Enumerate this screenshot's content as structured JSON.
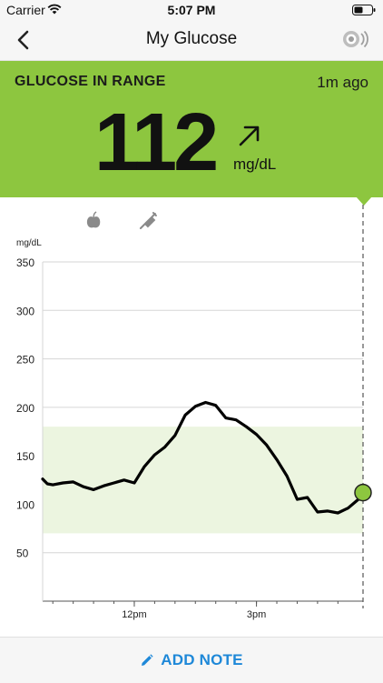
{
  "status_bar": {
    "carrier": "Carrier",
    "time": "5:07 PM"
  },
  "nav": {
    "title": "My Glucose",
    "back_icon": "chevron-left-icon",
    "sensor_icon": "sensor-scan-icon"
  },
  "banner": {
    "status": "GLUCOSE IN RANGE",
    "time_ago": "1m ago",
    "value": "112",
    "unit": "mg/dL",
    "trend_icon": "arrow-up-right-icon",
    "color": "#8dc63f"
  },
  "chart_data": {
    "type": "line",
    "ylabel": "mg/dL",
    "ylim": [
      0,
      350
    ],
    "y_ticks": [
      50,
      100,
      150,
      200,
      250,
      300,
      350
    ],
    "x_tick_labels": [
      "12pm",
      "3pm"
    ],
    "target_range": [
      70,
      180
    ],
    "grid": true,
    "event_markers": [
      {
        "icon": "food-apple-icon",
        "time": "11:00am"
      },
      {
        "icon": "insulin-pen-icon",
        "time": "12:20pm"
      }
    ],
    "series": [
      {
        "values": [
          [
            "9:45",
            126
          ],
          [
            "9:52",
            121
          ],
          [
            "10:00",
            120
          ],
          [
            "10:15",
            122
          ],
          [
            "10:30",
            123
          ],
          [
            "10:45",
            118
          ],
          [
            "11:00",
            115
          ],
          [
            "11:15",
            119
          ],
          [
            "11:30",
            122
          ],
          [
            "11:45",
            125
          ],
          [
            "12:00",
            122
          ],
          [
            "12:15",
            139
          ],
          [
            "12:30",
            151
          ],
          [
            "12:45",
            159
          ],
          [
            "1:00",
            171
          ],
          [
            "1:15",
            192
          ],
          [
            "1:30",
            201
          ],
          [
            "1:45",
            205
          ],
          [
            "2:00",
            202
          ],
          [
            "2:15",
            189
          ],
          [
            "2:30",
            187
          ],
          [
            "2:45",
            180
          ],
          [
            "3:00",
            172
          ],
          [
            "3:15",
            161
          ],
          [
            "3:30",
            146
          ],
          [
            "3:45",
            129
          ],
          [
            "4:00",
            105
          ],
          [
            "4:15",
            107
          ],
          [
            "4:30",
            92
          ],
          [
            "4:45",
            93
          ],
          [
            "5:00",
            91
          ],
          [
            "5:15",
            96
          ],
          [
            "5:30",
            105
          ],
          [
            "5:37",
            112
          ]
        ]
      }
    ],
    "current_point": {
      "time": "5:37",
      "value": 112
    }
  },
  "footer": {
    "add_note_label": "ADD NOTE",
    "icon": "pencil-icon"
  },
  "colors": {
    "accent": "#1e88d8",
    "in_range": "#8dc63f",
    "range_band": "#ecf5e0"
  }
}
